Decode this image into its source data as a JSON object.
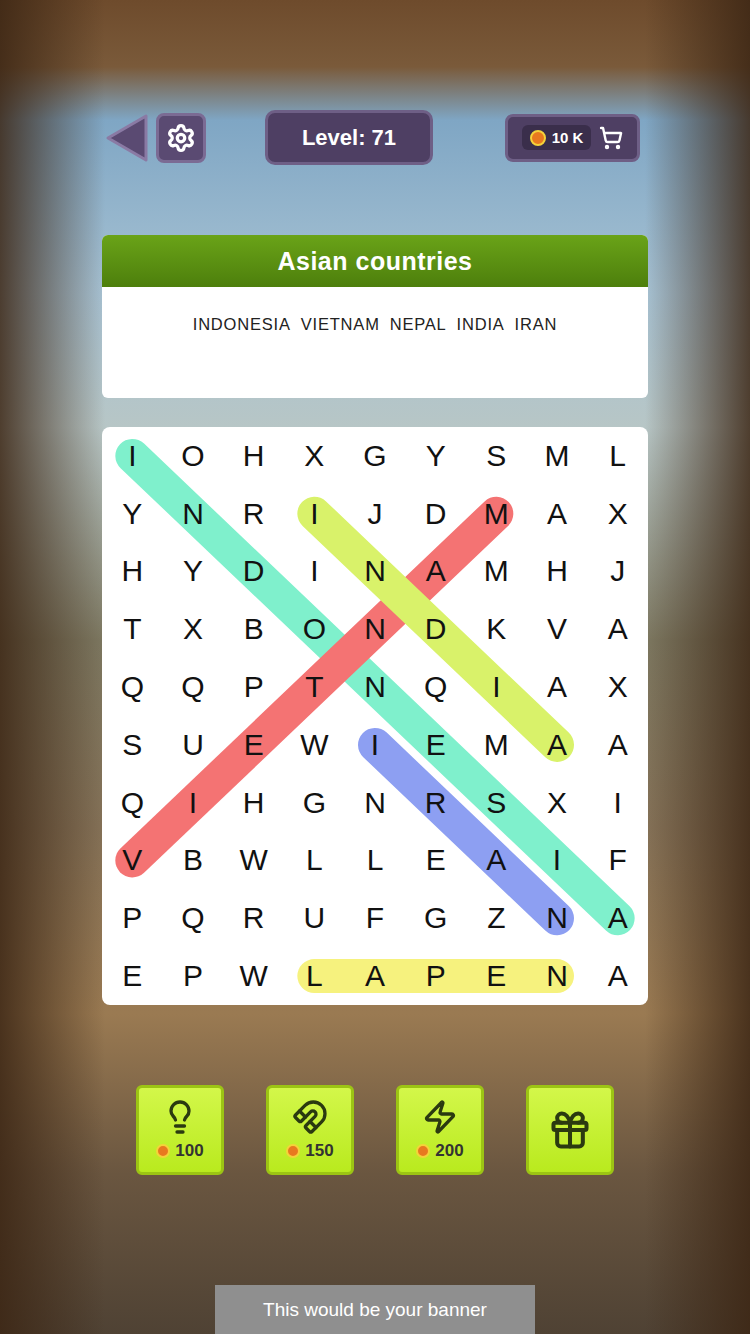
{
  "topbar": {
    "level": "Level: 71",
    "coins": "10 K"
  },
  "category": {
    "title": "Asian countries",
    "words": [
      "INDONESIA",
      "VIETNAM",
      "NEPAL",
      "INDIA",
      "IRAN"
    ]
  },
  "grid": {
    "rows": [
      [
        "I",
        "O",
        "H",
        "X",
        "G",
        "Y",
        "S",
        "M",
        "L"
      ],
      [
        "Y",
        "N",
        "R",
        "I",
        "J",
        "D",
        "M",
        "A",
        "X"
      ],
      [
        "H",
        "Y",
        "D",
        "I",
        "N",
        "A",
        "M",
        "H",
        "J"
      ],
      [
        "T",
        "X",
        "B",
        "O",
        "N",
        "D",
        "K",
        "V",
        "A"
      ],
      [
        "Q",
        "Q",
        "P",
        "T",
        "N",
        "Q",
        "I",
        "A",
        "X"
      ],
      [
        "S",
        "U",
        "E",
        "W",
        "I",
        "E",
        "M",
        "A",
        "A"
      ],
      [
        "Q",
        "I",
        "H",
        "G",
        "N",
        "R",
        "S",
        "X",
        "I"
      ],
      [
        "V",
        "B",
        "W",
        "L",
        "L",
        "E",
        "A",
        "I",
        "F"
      ],
      [
        "P",
        "Q",
        "R",
        "U",
        "F",
        "G",
        "Z",
        "N",
        "A"
      ],
      [
        "E",
        "P",
        "W",
        "L",
        "A",
        "P",
        "E",
        "N",
        "A"
      ]
    ]
  },
  "found": [
    {
      "word": "INDONESIA",
      "start": [
        0,
        0
      ],
      "end": [
        8,
        8
      ],
      "color": "#7ff0cc"
    },
    {
      "word": "VIETNAM",
      "start": [
        7,
        0
      ],
      "end": [
        1,
        6
      ],
      "color": "#f47373"
    },
    {
      "word": "INDIA",
      "start": [
        1,
        3
      ],
      "end": [
        5,
        7
      ],
      "color": "#d9f26a"
    },
    {
      "word": "IRAN",
      "start": [
        5,
        4
      ],
      "end": [
        8,
        7
      ],
      "color": "#8d9ff2"
    },
    {
      "word": "NEPAL",
      "start": [
        9,
        7
      ],
      "end": [
        9,
        3
      ],
      "color": "#f6f27e"
    }
  ],
  "boosters": [
    {
      "kind": "hint",
      "price": "100"
    },
    {
      "kind": "magnet",
      "price": "150"
    },
    {
      "kind": "lightning",
      "price": "200"
    },
    {
      "kind": "video",
      "price": ""
    }
  ],
  "banner": "This would be your banner"
}
